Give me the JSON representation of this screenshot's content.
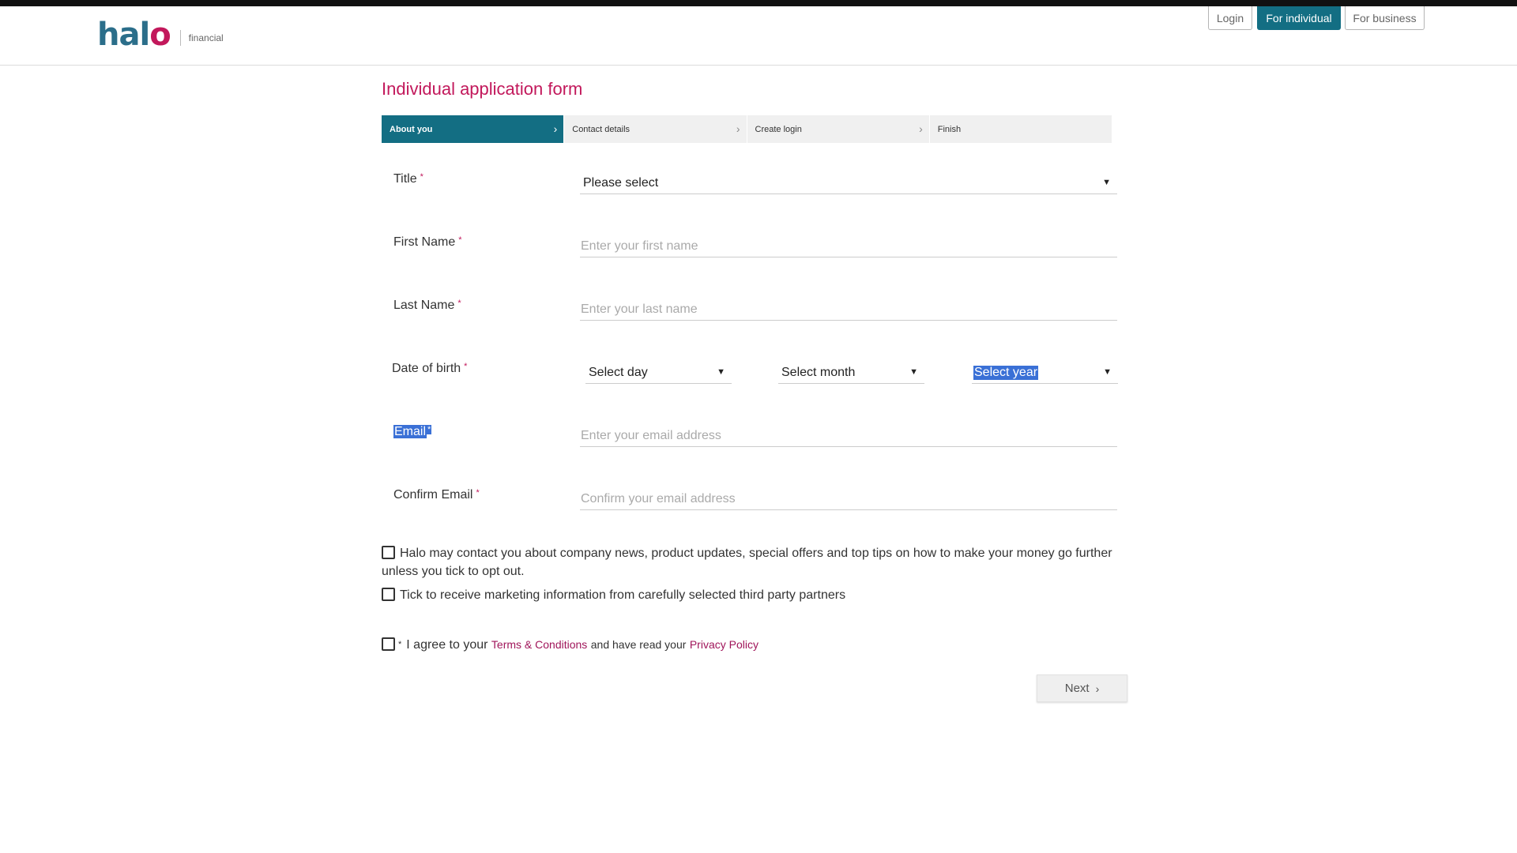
{
  "header": {
    "logo_main": "hal",
    "logo_o": "o",
    "logo_sub": "financial",
    "nav": {
      "login": "Login",
      "individual": "For individual",
      "business": "For business"
    }
  },
  "form": {
    "title": "Individual application form",
    "steps": [
      {
        "label": "About you"
      },
      {
        "label": "Contact details"
      },
      {
        "label": "Create login"
      },
      {
        "label": "Finish"
      }
    ],
    "required_mark": "*",
    "title_field": {
      "label": "Title",
      "value": "Please select"
    },
    "first_name": {
      "label": "First Name",
      "placeholder": "Enter your first name"
    },
    "last_name": {
      "label": "Last Name",
      "placeholder": "Enter your last name"
    },
    "dob": {
      "label": "Date of birth",
      "day": "Select day",
      "month": "Select month",
      "year": "Select year"
    },
    "email": {
      "label": "Email",
      "placeholder": "Enter your email address"
    },
    "confirm_email": {
      "label": "Confirm Email",
      "placeholder": "Confirm your email address"
    },
    "opt_out_text": "Halo may contact you about company news, product updates, special offers and top tips on how to make your money go further unless you tick to opt out.",
    "third_party_text": "Tick to receive marketing information from carefully selected third party partners",
    "agree_prefix": "I agree to your",
    "terms_link": "Terms & Conditions",
    "agree_middle": "and have read your",
    "privacy_link": "Privacy Policy",
    "next_label": "Next"
  },
  "colors": {
    "brand_teal": "#136e83",
    "brand_pink": "#c2185b",
    "selection": "#3a70d6"
  },
  "icons": {
    "step_chevron": "chevron-right-icon",
    "select_caret": "caret-down-icon"
  }
}
